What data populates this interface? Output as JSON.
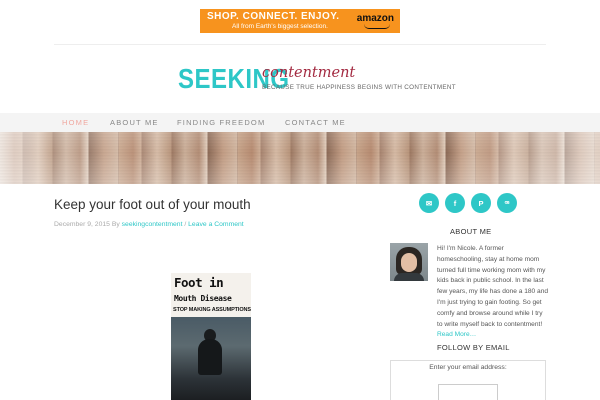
{
  "ad": {
    "headline": "SHOP.  CONNECT.  ENJOY.",
    "subline": "All from Earth's biggest selection.",
    "brand": "amazon",
    "color": "#f7931e"
  },
  "logo": {
    "word_seeking": "SEEKING",
    "word_contentment": "contentment",
    "tagline": "Because true happiness begins with contentment",
    "primary_color": "#2ec7c7",
    "secondary_color": "#a32a41"
  },
  "nav": {
    "items": [
      {
        "label": "HOME",
        "active": true
      },
      {
        "label": "ABOUT ME",
        "active": false
      },
      {
        "label": "FINDING FREEDOM",
        "active": false
      },
      {
        "label": "CONTACT ME",
        "active": false
      }
    ],
    "active_color": "#f0a8a0"
  },
  "post": {
    "title": "Keep your foot out of your mouth",
    "date": "December 9, 2015",
    "by": "By",
    "author": "seekingcontentment",
    "separator": "/",
    "comment_link": "Leave a Comment",
    "image_text": {
      "line1": "Foot in",
      "line2": "Mouth Disease",
      "line3": "STOP MAKING ASSUMPTIONS"
    }
  },
  "sidebar": {
    "social_icons": [
      {
        "name": "email-icon",
        "glyph": "✉"
      },
      {
        "name": "facebook-icon",
        "glyph": "f"
      },
      {
        "name": "pinterest-icon",
        "glyph": "P"
      },
      {
        "name": "stumbleupon-icon",
        "glyph": "ꟹ"
      }
    ],
    "about_heading": "ABOUT ME",
    "about_text": "Hi! I'm Nicole. A former homeschooling, stay at home mom turned full time working mom with my kids back in public school. In the last few years, my life has done a 180 and I'm just trying to gain footing. So get comfy and browse around while I try to write myself back to contentment!",
    "read_more": "Read More…",
    "follow_heading": "FOLLOW BY EMAIL",
    "email_label": "Enter your email address:"
  }
}
